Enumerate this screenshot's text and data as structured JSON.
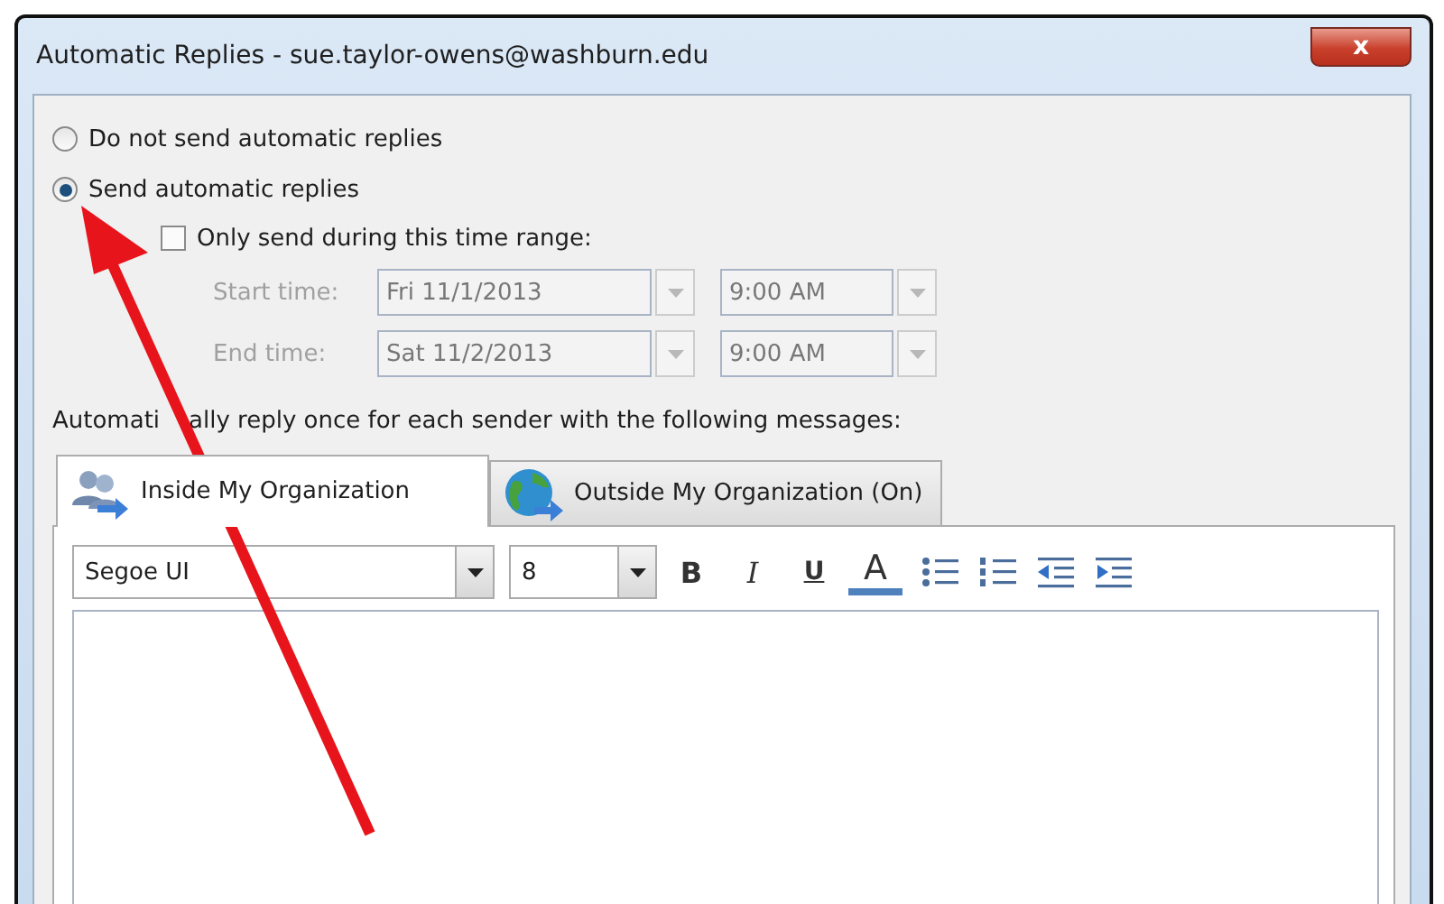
{
  "window": {
    "title": "Automatic Replies - sue.taylor-owens@washburn.edu",
    "close": "x"
  },
  "reply_mode": [
    {
      "label": "Do not send automatic replies",
      "selected": false
    },
    {
      "label": "Send automatic replies",
      "selected": true
    }
  ],
  "time_range": {
    "label": "Only send during this time range:",
    "checked": false,
    "disabled": true,
    "rows": [
      {
        "label": "Start time:",
        "date": "Fri 11/1/2013",
        "time": "9:00 AM"
      },
      {
        "label": "End time:",
        "date": "Sat 11/2/2013",
        "time": "9:00 AM"
      }
    ]
  },
  "instruction": [
    "Automati",
    "ally reply once for each sender with the following messages:"
  ],
  "tabs": [
    {
      "label": "Inside My Organization",
      "kind": "people",
      "selected": true
    },
    {
      "label": "Outside My Organization (On)",
      "kind": "globe",
      "selected": false
    }
  ],
  "toolbar": {
    "font": "Segoe UI",
    "size": "8",
    "buttons": [
      {
        "kind": "bold",
        "label": "B"
      },
      {
        "kind": "italic",
        "label": "I"
      },
      {
        "kind": "underline",
        "label": "U"
      },
      {
        "kind": "color",
        "label": "A"
      },
      {
        "kind": "bullets"
      },
      {
        "kind": "numbers"
      },
      {
        "kind": "outdent"
      },
      {
        "kind": "indent"
      }
    ]
  }
}
